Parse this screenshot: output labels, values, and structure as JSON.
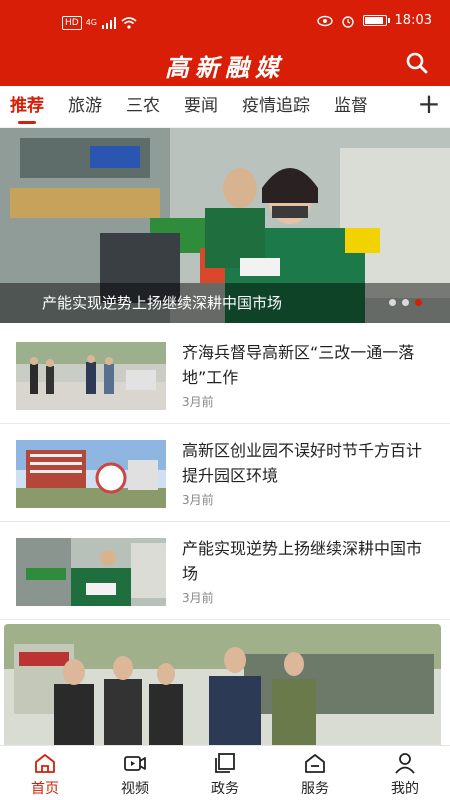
{
  "status_bar": {
    "left_indicators": [
      "HD",
      "4G",
      "signal",
      "wifi"
    ],
    "right_indicators": [
      "eye-icon",
      "alarm-icon"
    ],
    "battery_level": 0.85,
    "time": "18:03"
  },
  "app": {
    "title": "高新融媒",
    "search_icon": "search-icon",
    "brand_color": "#d81e06"
  },
  "tabs": {
    "items": [
      "推荐",
      "旅游",
      "三农",
      "要闻",
      "疫情追踪",
      "监督"
    ],
    "active_index": 0,
    "add_label": "+"
  },
  "banner": {
    "caption": "产能实现逆势上扬继续深耕中国市场",
    "dot_count": 3,
    "active_dot": 2
  },
  "news": [
    {
      "title": "齐海兵督导高新区“三改一通一落地”工作",
      "time": "3月前"
    },
    {
      "title": "高新区创业园不误好时节千方百计提升园区环境",
      "time": "3月前"
    },
    {
      "title": "产能实现逆势上扬继续深耕中国市场",
      "time": "3月前"
    }
  ],
  "bottom_nav": {
    "items": [
      {
        "label": "首页",
        "icon": "home-icon"
      },
      {
        "label": "视频",
        "icon": "video-icon"
      },
      {
        "label": "政务",
        "icon": "pages-icon"
      },
      {
        "label": "服务",
        "icon": "service-icon"
      },
      {
        "label": "我的",
        "icon": "user-icon"
      }
    ],
    "active_index": 0
  }
}
